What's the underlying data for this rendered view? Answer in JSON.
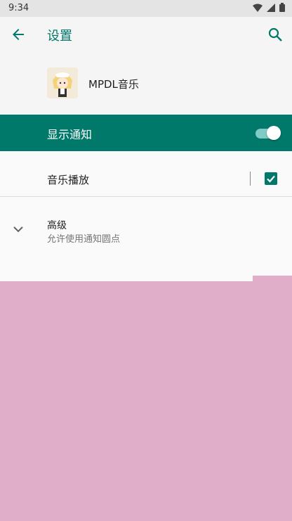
{
  "status_bar": {
    "time": "9:34"
  },
  "app_bar": {
    "title": "设置"
  },
  "app_info": {
    "name": "MPDL音乐"
  },
  "master_toggle": {
    "label": "显示通知",
    "enabled": true
  },
  "channel": {
    "label": "音乐播放",
    "checked": true
  },
  "advanced": {
    "title": "高级",
    "subtitle": "允许使用通知圆点"
  },
  "colors": {
    "accent": "#00796b",
    "overlay": "#e0aec8"
  }
}
